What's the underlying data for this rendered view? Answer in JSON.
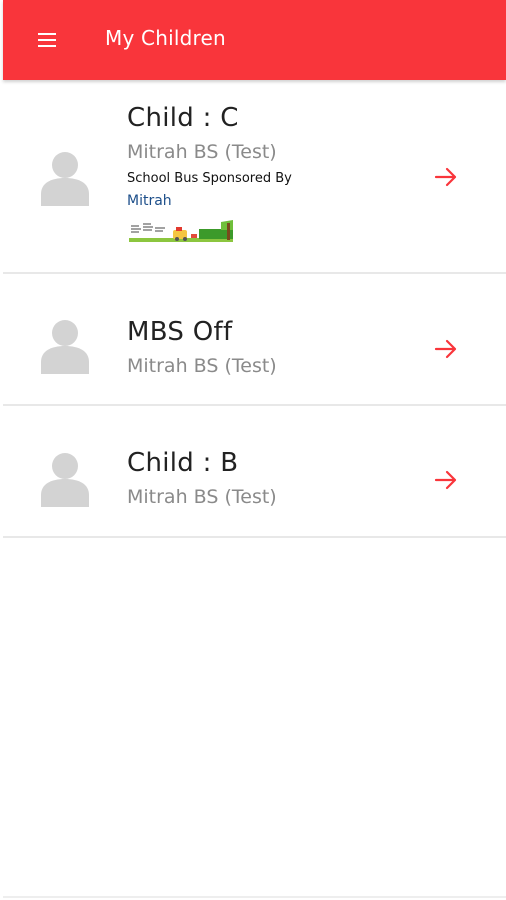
{
  "app_bar": {
    "title": "My Children",
    "menu_icon": "hamburger-menu-icon",
    "background_color": "#f9353b"
  },
  "children": [
    {
      "name": "Child : C",
      "school": "Mitrah BS (Test)",
      "sponsor_label": "School Bus Sponsored By",
      "sponsor_name": "Mitrah",
      "sponsor_banner_icon": "sponsor-banner-image",
      "action_icon": "arrow-right-icon"
    },
    {
      "name": "MBS Off",
      "school": "Mitrah BS (Test)",
      "action_icon": "arrow-right-icon"
    },
    {
      "name": "Child : B",
      "school": "Mitrah BS (Test)",
      "action_icon": "arrow-right-icon"
    }
  ],
  "colors": {
    "accent": "#f9353b",
    "avatar": "#d3d3d3",
    "secondary_text": "#8a8a8a",
    "sponsor_link": "#1d4f8a"
  }
}
